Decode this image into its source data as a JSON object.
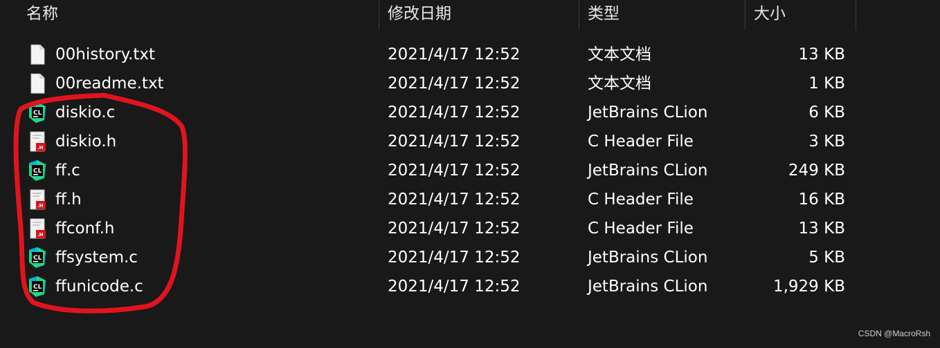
{
  "columns": {
    "name": "名称",
    "modified": "修改日期",
    "type": "类型",
    "size": "大小"
  },
  "files": [
    {
      "name": "00history.txt",
      "modified": "2021/4/17 12:52",
      "type": "文本文档",
      "size": "13 KB",
      "icon": "text-file-icon"
    },
    {
      "name": "00readme.txt",
      "modified": "2021/4/17 12:52",
      "type": "文本文档",
      "size": "1 KB",
      "icon": "text-file-icon"
    },
    {
      "name": "diskio.c",
      "modified": "2021/4/17 12:52",
      "type": "JetBrains CLion",
      "size": "6 KB",
      "icon": "clion-icon"
    },
    {
      "name": "diskio.h",
      "modified": "2021/4/17 12:52",
      "type": "C Header File",
      "size": "3 KB",
      "icon": "c-header-icon"
    },
    {
      "name": "ff.c",
      "modified": "2021/4/17 12:52",
      "type": "JetBrains CLion",
      "size": "249 KB",
      "icon": "clion-icon"
    },
    {
      "name": "ff.h",
      "modified": "2021/4/17 12:52",
      "type": "C Header File",
      "size": "16 KB",
      "icon": "c-header-icon"
    },
    {
      "name": "ffconf.h",
      "modified": "2021/4/17 12:52",
      "type": "C Header File",
      "size": "13 KB",
      "icon": "c-header-icon"
    },
    {
      "name": "ffsystem.c",
      "modified": "2021/4/17 12:52",
      "type": "JetBrains CLion",
      "size": "5 KB",
      "icon": "clion-icon"
    },
    {
      "name": "ffunicode.c",
      "modified": "2021/4/17 12:52",
      "type": "JetBrains CLion",
      "size": "1,929 KB",
      "icon": "clion-icon"
    }
  ],
  "icon_labels": {
    "clion": "CL",
    "header": ".H"
  },
  "colors": {
    "annotation": "#e0141e",
    "background": "#191919",
    "header_red": "#d4161d"
  },
  "watermark": "CSDN @MacroRsh"
}
